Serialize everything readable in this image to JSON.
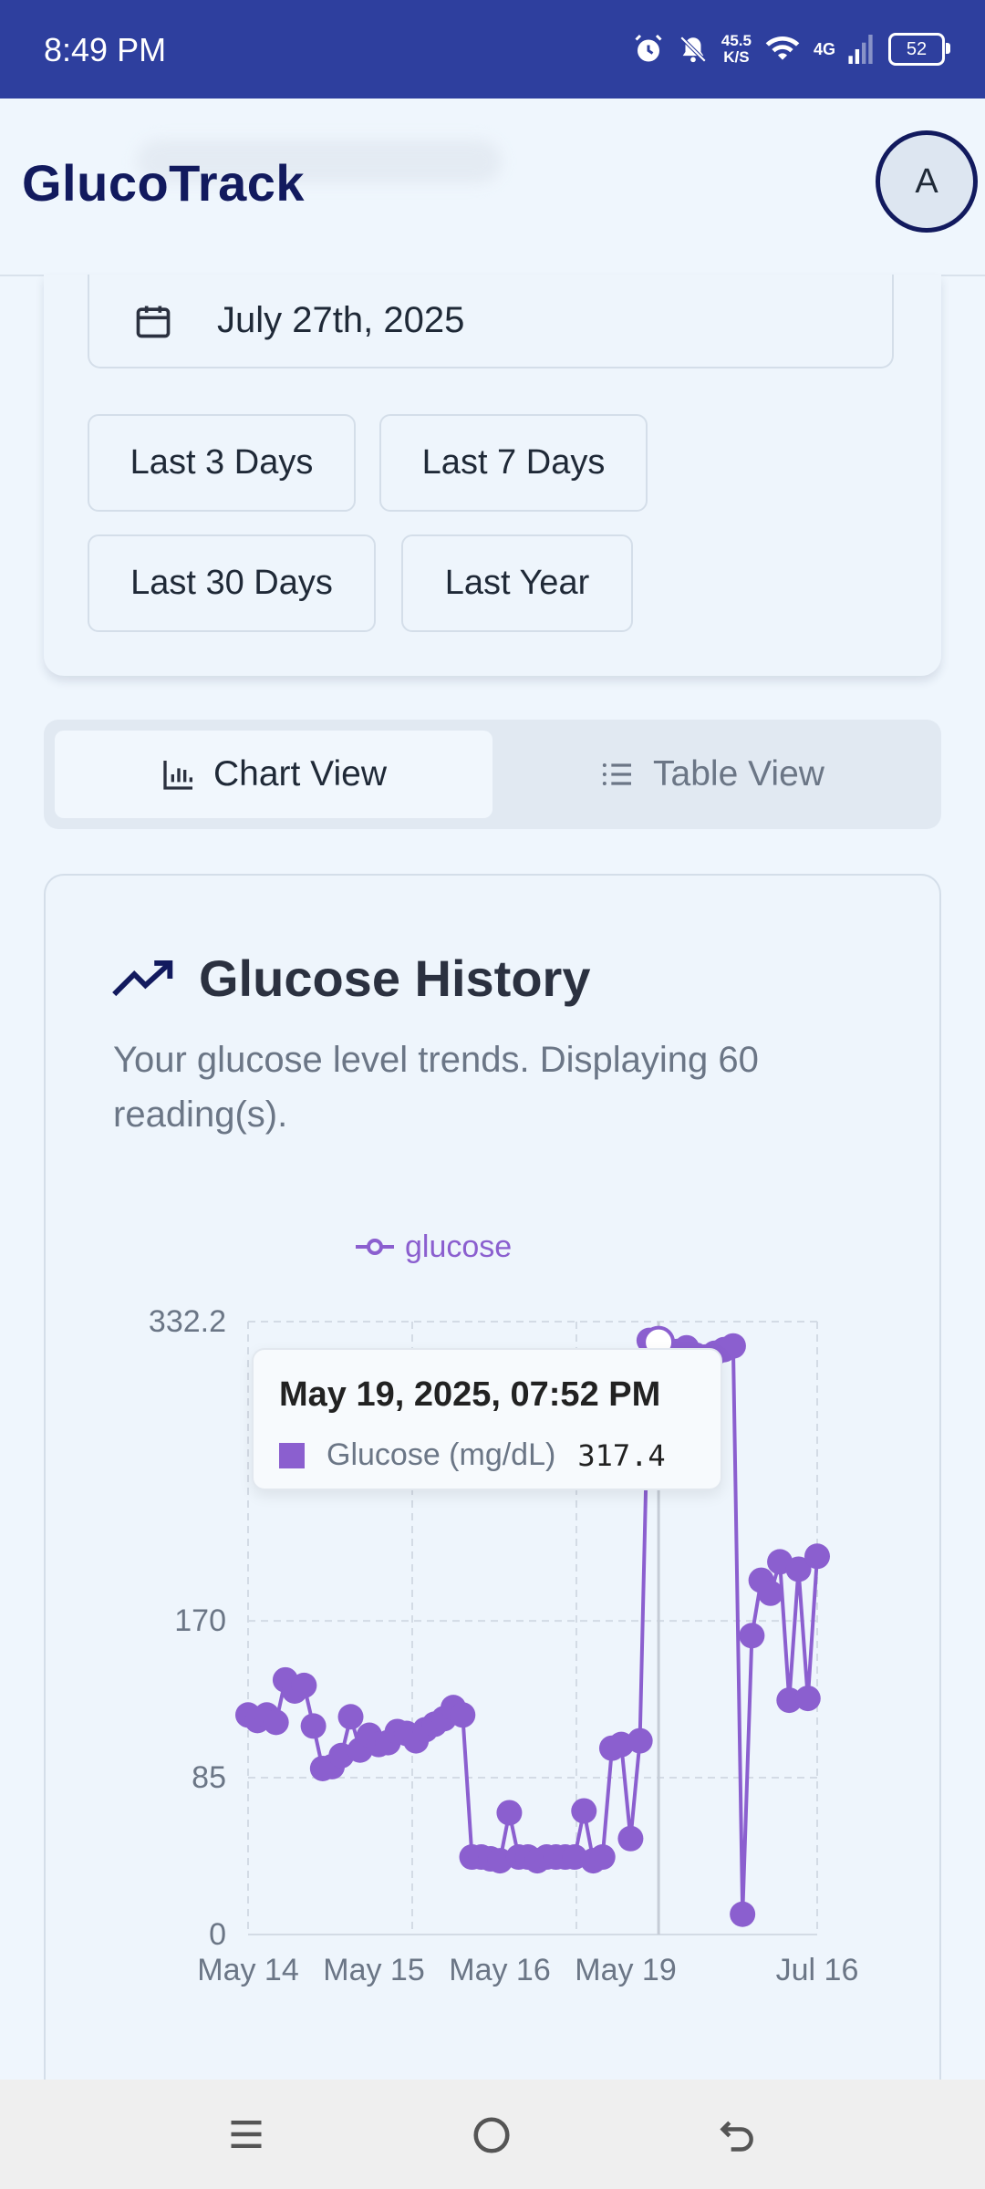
{
  "status_bar": {
    "time": "8:49 PM",
    "net_speed_value": "45.5",
    "net_speed_unit": "K/S",
    "network_type": "4G",
    "battery": "52"
  },
  "header": {
    "title": "GlucoTrack",
    "avatar_initial": "A"
  },
  "filters": {
    "date_value": "July 27th, 2025",
    "ranges": [
      "Last 3 Days",
      "Last 7 Days",
      "Last 30 Days",
      "Last Year"
    ]
  },
  "view_toggle": {
    "chart_label": "Chart View",
    "table_label": "Table View",
    "active": "chart"
  },
  "history": {
    "title": "Glucose History",
    "description": "Your glucose level trends. Displaying 60 reading(s)."
  },
  "tooltip": {
    "title": "May 19, 2025, 07:52 PM",
    "series_name": "Glucose (mg/dL)",
    "value": "317.4"
  },
  "colors": {
    "accent": "#8b5fcf",
    "header_bg": "#2e3f9e",
    "brand": "#121a5e",
    "background": "#eff6fd"
  },
  "chart_data": {
    "type": "line",
    "legend": [
      "glucose"
    ],
    "legend_position": "top-center",
    "grid": true,
    "ylim": [
      0,
      332.2
    ],
    "y_ticks": [
      "332.2",
      "170",
      "85",
      "0"
    ],
    "y_tick_values": [
      332.2,
      170,
      85,
      0
    ],
    "x_tick_labels": [
      "May 14",
      "May 15",
      "May 16",
      "May 19",
      "Jul 16"
    ],
    "series": [
      {
        "name": "glucose",
        "values": [
          119,
          116,
          119,
          115,
          138,
          132,
          135,
          113,
          90,
          91,
          97,
          118,
          100,
          108,
          103,
          104,
          110,
          109,
          105,
          111,
          114,
          117,
          123,
          119,
          42,
          42,
          41,
          40,
          66,
          42,
          42,
          40,
          42,
          42,
          42,
          42,
          67,
          40,
          42,
          101,
          103,
          52,
          105,
          322,
          321,
          315,
          316,
          318,
          314,
          313,
          315,
          317,
          319,
          11,
          162,
          192,
          185,
          202,
          127,
          198,
          128,
          205
        ]
      }
    ],
    "highlight_index": 44
  },
  "nav": [
    "menu-icon",
    "home-icon",
    "back-icon"
  ]
}
